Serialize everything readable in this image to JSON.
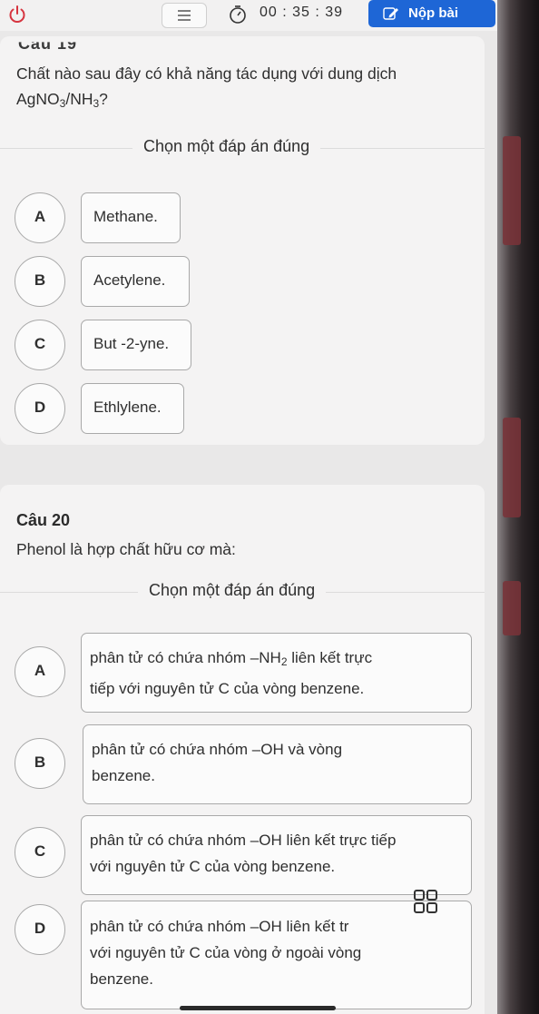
{
  "topbar": {
    "timer": "00 : 35 : 39",
    "submit_label": "Nộp bài"
  },
  "question19": {
    "heading_cut": "Câu 19",
    "text_line1": "Chất nào sau đây có khả năng tác dụng với dung dịch",
    "formula_a": "AgNO",
    "formula_a_sub": "3",
    "formula_slash": "/NH",
    "formula_b_sub": "3",
    "formula_end": "?",
    "instruction": "Chọn một đáp án đúng",
    "options": [
      {
        "letter": "A",
        "text": "Methane."
      },
      {
        "letter": "B",
        "text": "Acetylene."
      },
      {
        "letter": "C",
        "text": "But -2-yne."
      },
      {
        "letter": "D",
        "text": "Ethlylene."
      }
    ]
  },
  "question20": {
    "title": "Câu 20",
    "text": "Phenol là hợp chất hữu cơ mà:",
    "instruction": "Chọn một đáp án đúng",
    "options": [
      {
        "letter": "A",
        "line1_pre": "phân tử có chứa nhóm –NH",
        "line1_sub": "2",
        "line1_post": " liên kết trực",
        "line2": "tiếp với nguyên tử C của vòng benzene."
      },
      {
        "letter": "B",
        "line1": "phân tử có chứa nhóm –OH và vòng",
        "line2": "benzene."
      },
      {
        "letter": "C",
        "line1": "phân tử có chứa nhóm –OH liên kết trực tiếp",
        "line2": "với nguyên tử C của vòng benzene."
      },
      {
        "letter": "D",
        "line1": "phân tử có chứa nhóm –OH liên kết tr",
        "line2": "với nguyên tử C của vòng ở ngoài vòng",
        "line3": "benzene."
      }
    ]
  },
  "colors": {
    "accent": "#1e66d6",
    "power": "#d6343f",
    "background": "#e9e8e8"
  },
  "icons": [
    "power-icon",
    "menu-list-icon",
    "timer-icon",
    "edit-icon",
    "grid-icon"
  ]
}
